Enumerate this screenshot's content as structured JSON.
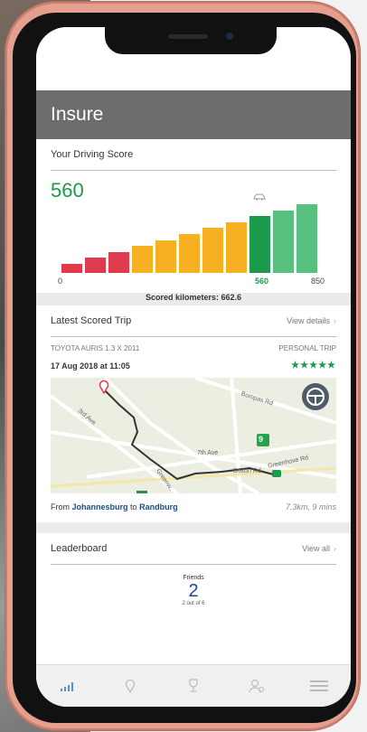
{
  "header": {
    "title": "Insure"
  },
  "score": {
    "title": "Your Driving Score",
    "value": "560",
    "axis_min": "0",
    "axis_current": "560",
    "axis_max": "850",
    "scored_km": "Scored kilometers: 662.6"
  },
  "trip": {
    "title": "Latest Scored Trip",
    "view_details": "View details",
    "vehicle": "TOYOTA AURIS 1.3 X 2011",
    "trip_type": "PERSONAL TRIP",
    "date": "17 Aug 2018 at 11:05",
    "stars": "★★★★★",
    "from_prefix": "From",
    "from_city": "Johannesburg",
    "to_word": "to",
    "to_city": "Randburg",
    "distance": "7.3km, 9 mins",
    "map_labels": {
      "road1": "3rd Ave",
      "road2": "Bompas Rd",
      "road3": "7th Ave",
      "road4": "Bolton Rd",
      "road5": "Greenhove Rd",
      "road6": "Greenw..",
      "route_badge": "9"
    }
  },
  "leaderboard": {
    "title": "Leaderboard",
    "view_all": "View all",
    "friends_label": "Friends",
    "friends_rank": "2",
    "friends_sub": "2 out of 6"
  },
  "colors": {
    "green": "#1a9a4a",
    "light_green": "#58c07f",
    "amber": "#f6b022",
    "red": "#e03a4e",
    "link_blue": "#1b4b8a"
  },
  "nav": [
    "stats-icon",
    "location-icon",
    "trophy-icon",
    "profile-icon",
    "menu-icon"
  ]
}
